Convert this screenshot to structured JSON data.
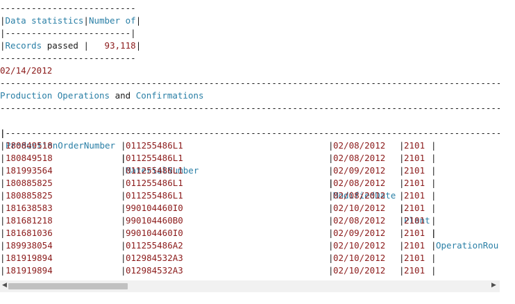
{
  "stats": {
    "rule_top": "--------------------------",
    "header_col1": "Data statistics",
    "header_col2": "Number of",
    "rule_mid": "|------------------------|",
    "row_label_blue": "Records",
    "row_label_dark": " passed ",
    "row_value": "   93,118",
    "rule_bottom": "--------------------------"
  },
  "date": "02/14/2012",
  "rule_long": "-------------------------------------------------------------------------------------------------------------------------",
  "title": {
    "word1": "Production Operations",
    "and": " and ",
    "word2": "Confirmations"
  },
  "table": {
    "columns": [
      "ProductionOrderNumber",
      "MaterialNumber",
      "ModifiedDate",
      "Plant",
      "OperationRou"
    ],
    "header_rule": "|------------------------------------------------------------------------------------------------------------------------",
    "rows": [
      [
        "180849518",
        "011255486L1",
        "02/08/2012",
        "2101"
      ],
      [
        "180849518",
        "011255486L1",
        "02/08/2012",
        "2101"
      ],
      [
        "181993564",
        "011255486L1",
        "02/09/2012",
        "2101"
      ],
      [
        "180885825",
        "011255486L1",
        "02/08/2012",
        "2101"
      ],
      [
        "180885825",
        "011255486L1",
        "02/08/2012",
        "2101"
      ],
      [
        "181638583",
        "990104460I0",
        "02/10/2012",
        "2101"
      ],
      [
        "181681218",
        "990104460B0",
        "02/08/2012",
        "2101"
      ],
      [
        "181681036",
        "990104460I0",
        "02/09/2012",
        "2101"
      ],
      [
        "189938054",
        "011255486A2",
        "02/10/2012",
        "2101"
      ],
      [
        "181919894",
        "012984532A3",
        "02/10/2012",
        "2101"
      ],
      [
        "181919894",
        "012984532A3",
        "02/10/2012",
        "2101"
      ]
    ]
  },
  "scrollbar": {
    "left_arrow_icon": "triangle-left",
    "right_arrow_icon": "triangle-right"
  }
}
